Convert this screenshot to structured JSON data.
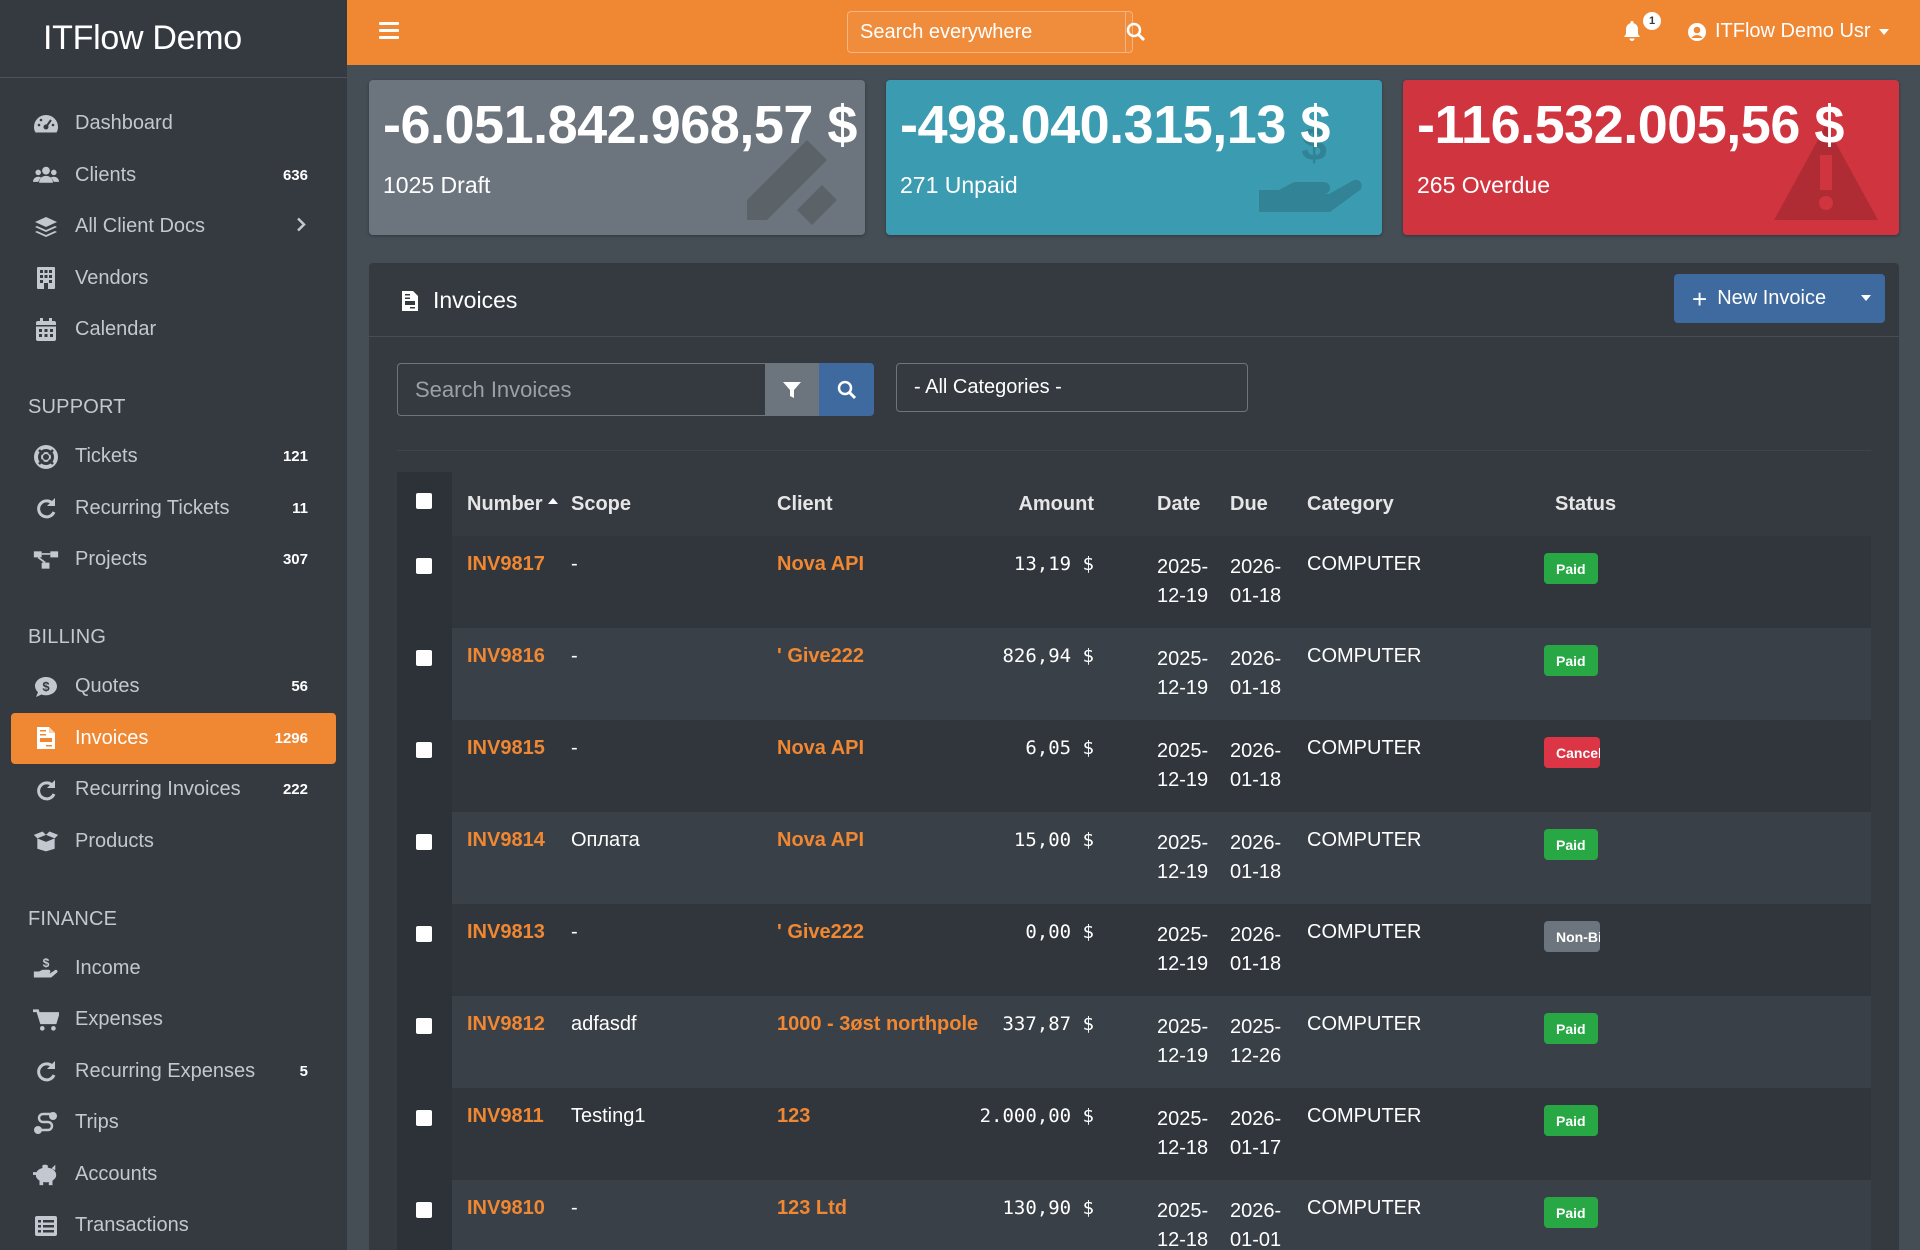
{
  "app": {
    "brand": "ITFlow Demo"
  },
  "topbar": {
    "search_placeholder": "Search everywhere",
    "notification_count": "1",
    "user_name": "ITFlow Demo Usr"
  },
  "sidebar": {
    "main": [
      {
        "label": "Dashboard",
        "icon": "dashboard-icon"
      },
      {
        "label": "Clients",
        "count": "636",
        "icon": "users-icon"
      },
      {
        "label": "All Client Docs",
        "icon": "layers-icon"
      },
      {
        "label": "Vendors",
        "icon": "building-icon"
      },
      {
        "label": "Calendar",
        "icon": "calendar-icon"
      }
    ],
    "support_header": "SUPPORT",
    "support": [
      {
        "label": "Tickets",
        "count": "121",
        "icon": "life-ring-icon"
      },
      {
        "label": "Recurring Tickets",
        "count": "11",
        "icon": "redo-icon"
      },
      {
        "label": "Projects",
        "count": "307",
        "icon": "project-diagram-icon"
      }
    ],
    "billing_header": "BILLING",
    "billing": [
      {
        "label": "Quotes",
        "count": "56",
        "icon": "comment-dollar-icon"
      },
      {
        "label": "Invoices",
        "count": "1296",
        "icon": "invoice-icon"
      },
      {
        "label": "Recurring Invoices",
        "count": "222",
        "icon": "redo-icon"
      },
      {
        "label": "Products",
        "icon": "box-open-icon"
      }
    ],
    "finance_header": "FINANCE",
    "finance": [
      {
        "label": "Income",
        "icon": "hand-holding-dollar-icon"
      },
      {
        "label": "Expenses",
        "icon": "shopping-cart-icon"
      },
      {
        "label": "Recurring Expenses",
        "count": "5",
        "icon": "redo-icon"
      },
      {
        "label": "Trips",
        "icon": "route-icon"
      },
      {
        "label": "Accounts",
        "icon": "piggy-bank-icon"
      },
      {
        "label": "Transactions",
        "icon": "list-icon"
      }
    ]
  },
  "stats": [
    {
      "amount": "-6.051.842.968,57 $",
      "label": "1025 Draft",
      "color": "#6c757d"
    },
    {
      "amount": "-498.040.315,13 $",
      "label": "271 Unpaid",
      "color": "#3b9bb0"
    },
    {
      "amount": "-116.532.005,56 $",
      "label": "265 Overdue",
      "color": "#d0343f"
    }
  ],
  "card": {
    "title": "Invoices",
    "new_button": "New Invoice",
    "search_placeholder": "Search Invoices",
    "category_select": "- All Categories -"
  },
  "table": {
    "headers": {
      "number": "Number",
      "scope": "Scope",
      "client": "Client",
      "amount": "Amount",
      "date": "Date",
      "due": "Due",
      "category": "Category",
      "status": "Status"
    },
    "rows": [
      {
        "number": "INV9817",
        "scope": "-",
        "client": "Nova API",
        "amount": "13,19 $",
        "date": "2025-12-19",
        "due": "2026-01-18",
        "category": "COMPUTER",
        "status": "Paid"
      },
      {
        "number": "INV9816",
        "scope": "-",
        "client": "' Give222",
        "amount": "826,94 $",
        "date": "2025-12-19",
        "due": "2026-01-18",
        "category": "COMPUTER",
        "status": "Paid"
      },
      {
        "number": "INV9815",
        "scope": "-",
        "client": "Nova API",
        "amount": "6,05 $",
        "date": "2025-12-19",
        "due": "2026-01-18",
        "category": "COMPUTER",
        "status": "Cancell"
      },
      {
        "number": "INV9814",
        "scope": "Оплата",
        "client": "Nova API",
        "amount": "15,00 $",
        "date": "2025-12-19",
        "due": "2026-01-18",
        "category": "COMPUTER",
        "status": "Paid"
      },
      {
        "number": "INV9813",
        "scope": "-",
        "client": "' Give222",
        "amount": "0,00 $",
        "date": "2025-12-19",
        "due": "2026-01-18",
        "category": "COMPUTER",
        "status": "Non-Bil"
      },
      {
        "number": "INV9812",
        "scope": "adfasdf",
        "client": "1000 - 3øst northpole",
        "amount": "337,87 $",
        "date": "2025-12-19",
        "due": "2025-12-26",
        "category": "COMPUTER",
        "status": "Paid"
      },
      {
        "number": "INV9811",
        "scope": "Testing1",
        "client": "123",
        "amount": "2.000,00 $",
        "date": "2025-12-18",
        "due": "2026-01-17",
        "category": "COMPUTER",
        "status": "Paid"
      },
      {
        "number": "INV9810",
        "scope": "-",
        "client": "123 Ltd",
        "amount": "130,90 $",
        "date": "2025-12-18",
        "due": "2026-01-01",
        "category": "COMPUTER",
        "status": "Paid"
      }
    ]
  },
  "colors": {
    "accent": "#ef8733",
    "sidebar": "#343a40",
    "paid": "#28a745",
    "cancelled": "#dc3545",
    "nonbillable": "#6c757d",
    "primary": "#3f6aa0"
  }
}
